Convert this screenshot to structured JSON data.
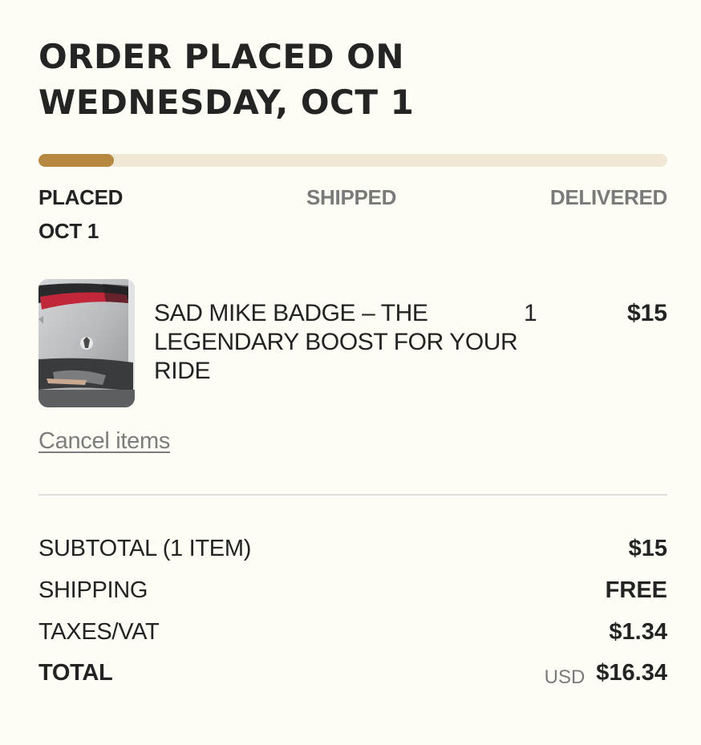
{
  "order": {
    "title_line1": "ORDER PLACED ON",
    "title_line2": "WEDNESDAY, OCT 1"
  },
  "progress": {
    "fraction": 0.12,
    "fill_color": "#b7883f",
    "track_color": "#f0e7d4",
    "steps": [
      {
        "label": "PLACED",
        "active": true,
        "date": "OCT 1"
      },
      {
        "label": "SHIPPED",
        "active": false
      },
      {
        "label": "DELIVERED",
        "active": false
      }
    ]
  },
  "item": {
    "name": "SAD MIKE BADGE – THE LEGENDARY BOOST FOR YOUR RIDE",
    "quantity": "1",
    "price": "$15"
  },
  "actions": {
    "cancel_label": "Cancel items"
  },
  "summary": {
    "subtotal_label": "SUBTOTAL (1 ITEM)",
    "subtotal_value": "$15",
    "shipping_label": "SHIPPING",
    "shipping_value": "FREE",
    "taxes_label": "TAXES/VAT",
    "taxes_value": "$1.34",
    "total_label": "TOTAL",
    "total_currency": "USD",
    "total_value": "$16.34"
  },
  "colors": {
    "background": "#fdfcf5",
    "text": "#232323",
    "muted": "#7a7a7a",
    "accent": "#b7883f"
  }
}
